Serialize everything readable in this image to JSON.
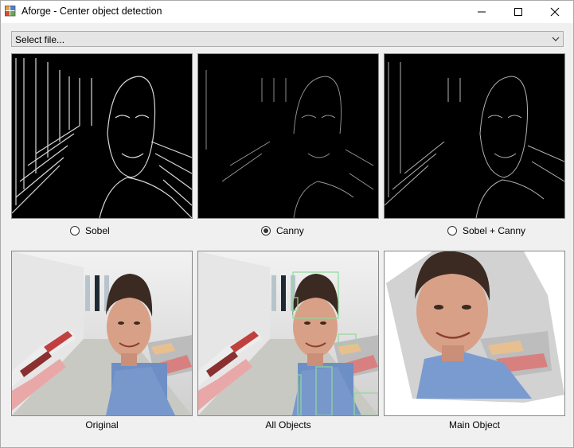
{
  "window": {
    "title": "Aforge - Center object detection"
  },
  "file_select": {
    "value": "Select file..."
  },
  "modes": [
    {
      "label": "Sobel",
      "checked": false
    },
    {
      "label": "Canny",
      "checked": true
    },
    {
      "label": "Sobel + Canny",
      "checked": false
    }
  ],
  "captions": {
    "original": "Original",
    "all_objects": "All Objects",
    "main_object": "Main Object"
  },
  "colors": {
    "detection_box": "#8fd99a",
    "radio_selected": "#333333"
  }
}
